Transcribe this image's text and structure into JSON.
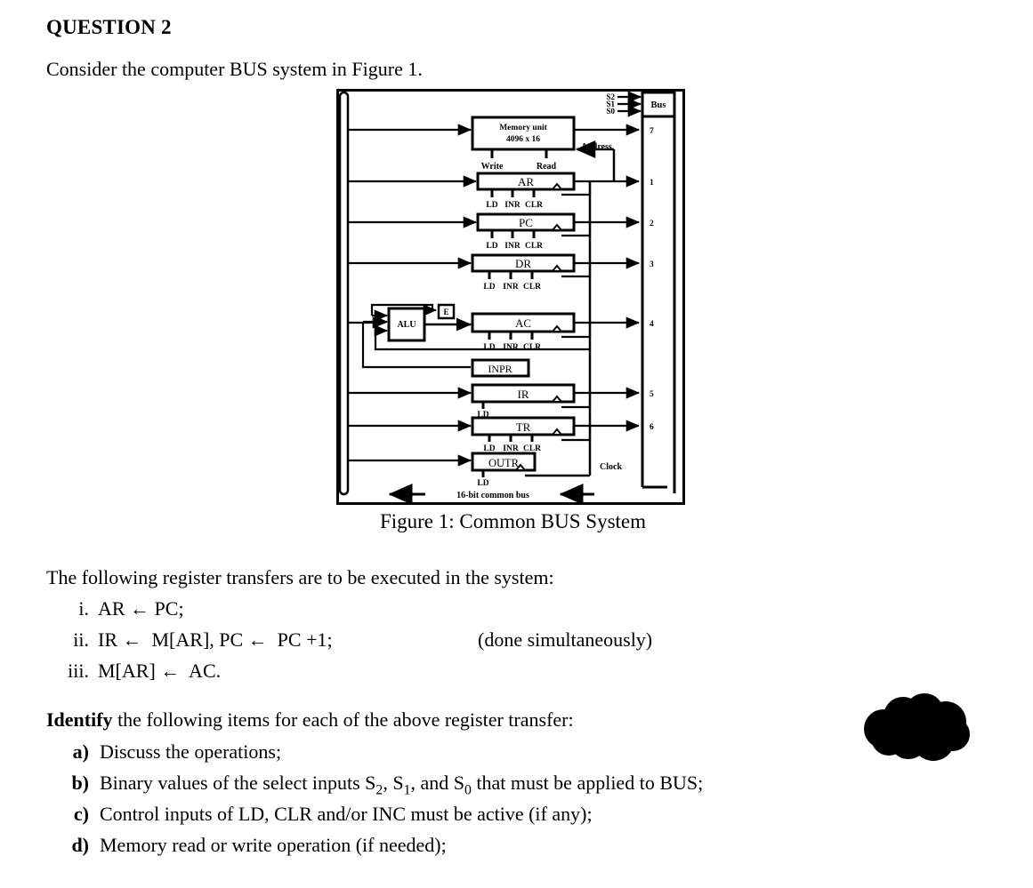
{
  "question": {
    "title": "QUESTION 2",
    "intro": "Consider the computer BUS system in Figure 1."
  },
  "figure": {
    "caption": "Figure 1: Common BUS System",
    "bus_label": "Bus",
    "select_inputs": [
      "S2",
      "S1",
      "S0"
    ],
    "memory": {
      "line1": "Memory unit",
      "line2": "4096 x 16",
      "write_label": "Write",
      "read_label": "Read",
      "address_label": "Address"
    },
    "alu_label": "ALU",
    "e_label": "E",
    "clock_label": "Clock",
    "bottom_bus_label": "16-bit common bus",
    "control_triple": [
      "LD",
      "INR",
      "CLR"
    ],
    "control_single": "LD",
    "registers": [
      {
        "name": "AR",
        "bus_index": "1",
        "controls": [
          "LD",
          "INR",
          "CLR"
        ]
      },
      {
        "name": "PC",
        "bus_index": "2",
        "controls": [
          "LD",
          "INR",
          "CLR"
        ]
      },
      {
        "name": "DR",
        "bus_index": "3",
        "controls": [
          "LD",
          "INR",
          "CLR"
        ]
      },
      {
        "name": "AC",
        "bus_index": "4",
        "controls": [
          "LD",
          "INR",
          "CLR"
        ]
      },
      {
        "name": "INPR",
        "bus_index": "",
        "controls": []
      },
      {
        "name": "IR",
        "bus_index": "5",
        "controls": [
          "LD"
        ]
      },
      {
        "name": "TR",
        "bus_index": "6",
        "controls": [
          "LD",
          "INR",
          "CLR"
        ]
      },
      {
        "name": "OUTR",
        "bus_index": "",
        "controls": [
          "LD"
        ]
      }
    ],
    "bus_indices": [
      "7",
      "1",
      "2",
      "3",
      "4",
      "5",
      "6"
    ]
  },
  "transfers": {
    "lead": "The following register transfers are to be executed in the system:",
    "items": [
      {
        "num": "i.",
        "text": "AR ← PC;",
        "note": ""
      },
      {
        "num": "ii.",
        "text": "IR ←  M[AR], PC ←  PC +1;",
        "note": "(done simultaneously)"
      },
      {
        "num": "iii.",
        "text": "M[AR] ←  AC.",
        "note": ""
      }
    ]
  },
  "identify": {
    "lead_bold": "Identify",
    "lead_rest": " the following items for each of the above register transfer:",
    "items": [
      {
        "num": "a)",
        "text": "Discuss the operations;"
      },
      {
        "num": "b)",
        "text": "Binary values of the select inputs S",
        "sub1": "2",
        "mid1": ", S",
        "sub2": "1",
        "mid2": ", and S",
        "sub3": "0",
        "tail": " that must be applied to BUS;"
      },
      {
        "num": "c)",
        "text": "Control inputs of LD, CLR and/or INC must be active (if any);"
      },
      {
        "num": "d)",
        "text": "Memory read or write operation (if needed);"
      }
    ]
  },
  "colors": {
    "ink": "#000000",
    "page": "#ffffff",
    "redaction": "#000000"
  }
}
